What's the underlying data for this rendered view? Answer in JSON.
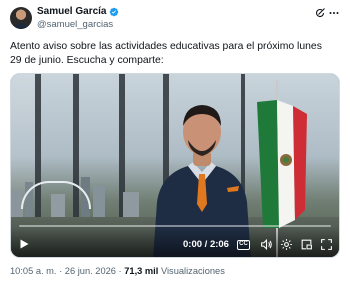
{
  "author": {
    "name": "Samuel García",
    "handle": "@samuel_garcias",
    "verified": true,
    "verified_color": "#1d9bf0"
  },
  "tweet": {
    "text": "Atento aviso sobre las actividades educativas para el próximo lunes 29 de junio. Escucha y comparte:"
  },
  "video": {
    "current_time": "0:00",
    "duration": "2:06",
    "time_separator": " / ",
    "progress": 0.0,
    "cc_label": "CC",
    "accent_color": "#1d9bf0"
  },
  "meta": {
    "time": "10:05 a. m.",
    "separator": " · ",
    "date": "26 jun. 2026",
    "views_count": "71,3 mil",
    "views_label": "Visualizaciones"
  },
  "icons": {
    "grok": "grok-icon",
    "more": "more-icon",
    "play": "play-icon",
    "captions": "captions-icon",
    "volume": "volume-icon",
    "settings": "settings-icon",
    "pip": "picture-in-picture-icon",
    "fullscreen": "fullscreen-icon"
  }
}
